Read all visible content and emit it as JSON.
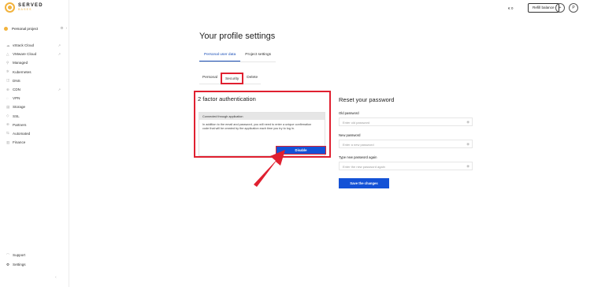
{
  "brand": {
    "name": "SERVED",
    "sub": "BASES",
    "accent": "#f2b33d"
  },
  "sidebar": {
    "project": "Personal project",
    "items": [
      {
        "label": "vStack Cloud",
        "icon": "cloud-icon",
        "external": true
      },
      {
        "label": "VMware Cloud",
        "icon": "vmware-icon",
        "external": true
      },
      {
        "label": "Managed",
        "icon": "managed-icon",
        "external": false
      },
      {
        "label": "Kubernetes",
        "icon": "kubernetes-icon",
        "external": false
      },
      {
        "label": "DNS",
        "icon": "dns-icon",
        "external": false
      },
      {
        "label": "CDN",
        "icon": "cdn-icon",
        "external": true
      },
      {
        "label": "VPN",
        "icon": "vpn-icon",
        "external": false
      },
      {
        "label": "Storage",
        "icon": "storage-icon",
        "external": false
      },
      {
        "label": "SSL",
        "icon": "ssl-icon",
        "external": false
      },
      {
        "label": "Partners",
        "icon": "partners-icon",
        "external": false
      },
      {
        "label": "Automated",
        "icon": "automated-icon",
        "external": false
      },
      {
        "label": "Finance",
        "icon": "finance-icon",
        "external": false
      }
    ],
    "bottom": [
      {
        "label": "Support",
        "icon": "support-icon"
      },
      {
        "label": "Settings",
        "icon": "settings-icon"
      }
    ]
  },
  "topbar": {
    "balance": "€ 0",
    "refill": "Refill balance",
    "plus": "+",
    "avatar": "P"
  },
  "page": {
    "title": "Your profile settings",
    "tabs": [
      "Personal user data",
      "Project settings"
    ],
    "subtabs": [
      "Personal",
      "Security",
      "Delete"
    ]
  },
  "twofa": {
    "title": "2 factor authentication",
    "status": "Connected through application",
    "description": "In addition to the email and password, you will need to enter a unique confirmation code that will be created by the application each time you try to log in.",
    "disable": "Disable"
  },
  "reset": {
    "title": "Reset your password",
    "old_label": "Old password",
    "old_placeholder": "Enter old password",
    "new_label": "New password",
    "new_placeholder": "Enter a new password",
    "again_label": "Type new password again",
    "again_placeholder": "Enter the new password again",
    "save": "Save the changes"
  },
  "colors": {
    "primary": "#1452d6",
    "highlight": "#e02030",
    "tab_active": "#1a4fb8"
  }
}
